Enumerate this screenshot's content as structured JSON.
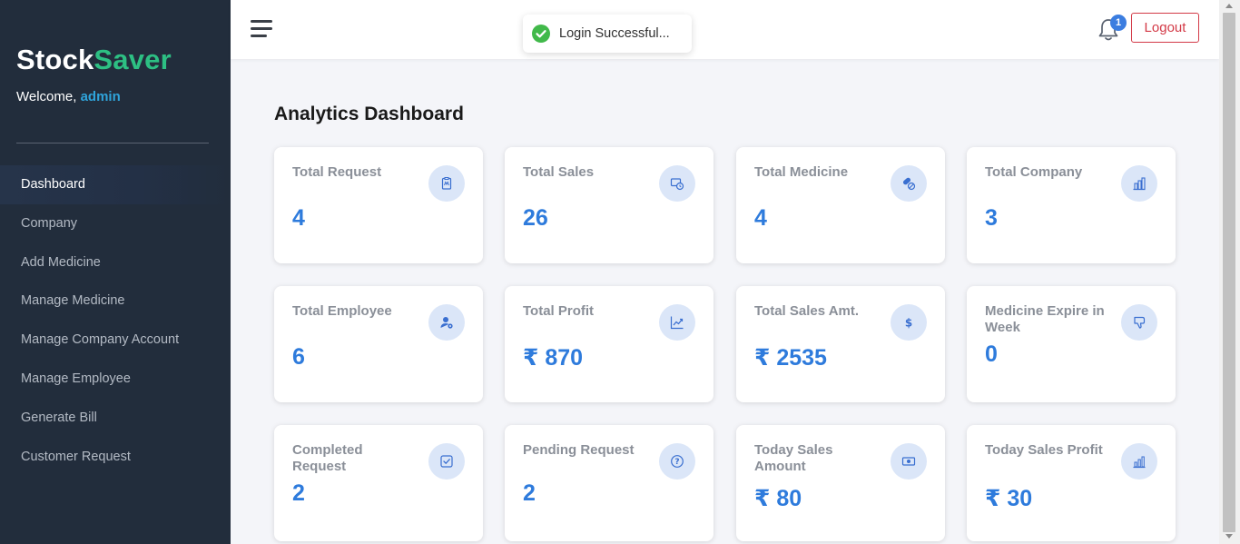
{
  "brand": {
    "prefix": "Stock",
    "accent": "Saver"
  },
  "welcome": {
    "text": "Welcome, ",
    "user": "admin"
  },
  "nav": [
    {
      "label": "Dashboard",
      "active": true
    },
    {
      "label": "Company"
    },
    {
      "label": "Add Medicine"
    },
    {
      "label": "Manage Medicine"
    },
    {
      "label": "Manage Company Account"
    },
    {
      "label": "Manage Employee"
    },
    {
      "label": "Generate Bill"
    },
    {
      "label": "Customer Request"
    }
  ],
  "topbar": {
    "notification_count": "1",
    "logout_label": "Logout"
  },
  "toast": {
    "message": "Login Successful..."
  },
  "page_title": {
    "bold": "Analytics",
    "rest": " Dashboard"
  },
  "cards": [
    {
      "label": "Total Request",
      "value": "4",
      "icon": "clipboard-icon"
    },
    {
      "label": "Total Sales",
      "value": "26",
      "icon": "sales-icon"
    },
    {
      "label": "Total Medicine",
      "value": "4",
      "icon": "pills-icon"
    },
    {
      "label": "Total Company",
      "value": "3",
      "icon": "building-icon"
    },
    {
      "label": "Total Employee",
      "value": "6",
      "icon": "user-icon"
    },
    {
      "label": "Total Profit",
      "value": "₹ 870",
      "icon": "trend-up-icon"
    },
    {
      "label": "Total Sales Amt.",
      "value": "₹ 2535",
      "icon": "dollar-icon"
    },
    {
      "label": "Medicine Expire in Week",
      "value": "0",
      "icon": "thumbs-down-icon"
    },
    {
      "label": "Completed Request",
      "value": "2",
      "icon": "check-square-icon"
    },
    {
      "label": "Pending Request",
      "value": "2",
      "icon": "question-icon"
    },
    {
      "label": "Today Sales Amount",
      "value": "₹ 80",
      "icon": "cash-icon"
    },
    {
      "label": "Today Sales Profit",
      "value": "₹ 30",
      "icon": "bar-chart-icon"
    }
  ],
  "colors": {
    "sidebar": "#222d3c",
    "brand_accent": "#2dbf83",
    "value": "#2e7bdc",
    "logout": "#d33a47"
  }
}
